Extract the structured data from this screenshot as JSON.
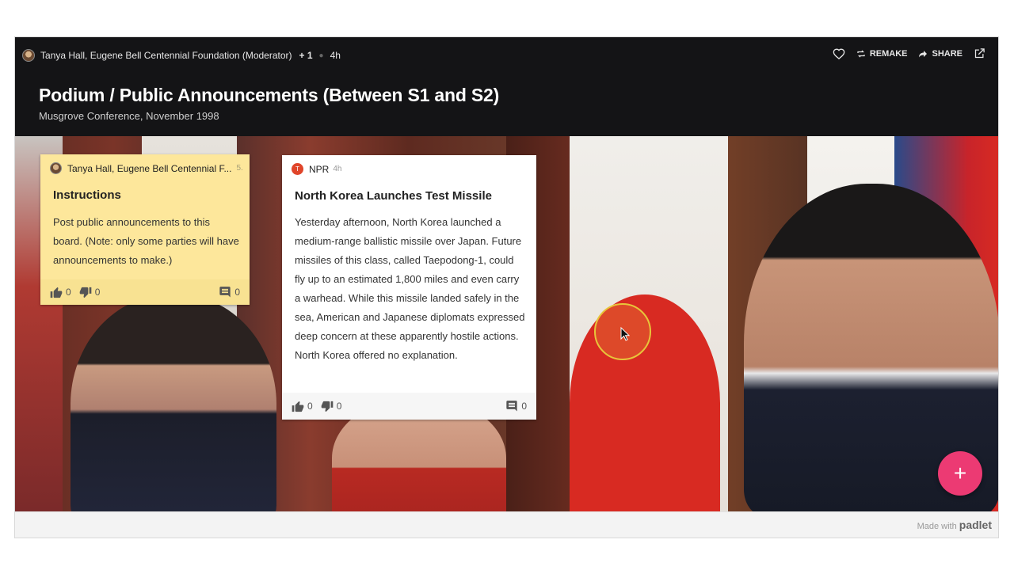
{
  "header": {
    "author": "Tanya Hall, Eugene Bell Centennial Foundation (Moderator)",
    "contributors": "+ 1",
    "age": "4h",
    "remake_label": "REMAKE",
    "share_label": "SHARE",
    "title": "Podium / Public Announcements (Between S1 and S2)",
    "subtitle": "Musgrove Conference, November 1998"
  },
  "posts": [
    {
      "author": "Tanya Hall, Eugene Bell Centennial F...",
      "age": "5.",
      "title": "Instructions",
      "body": "Post public announcements to this board. (Note: only some parties will have announcements to make.)",
      "likes": "0",
      "dislikes": "0",
      "comments": "0",
      "color": "#fde79b"
    },
    {
      "author": "NPR",
      "age": "4h",
      "avatar_letter": "T",
      "title": "North Korea Launches Test Missile",
      "body": "Yesterday afternoon, North Korea launched a medium-range ballistic missile over Japan. Future missiles of this class, called Taepodong-1, could fly up to an estimated 1,800 miles and even carry a warhead. While this missile landed safely in the sea, American and Japanese diplomats expressed deep concern at these apparently hostile actions. North Korea offered no explanation.",
      "likes": "0",
      "dislikes": "0",
      "comments": "0",
      "color": "#ffffff"
    }
  ],
  "fab_label": "+",
  "footer": {
    "made_with": "Made with",
    "brand": "padlet"
  },
  "colors": {
    "accent": "#ec3a73",
    "header_bg": "#141416",
    "npr_avatar": "#e0452a"
  }
}
